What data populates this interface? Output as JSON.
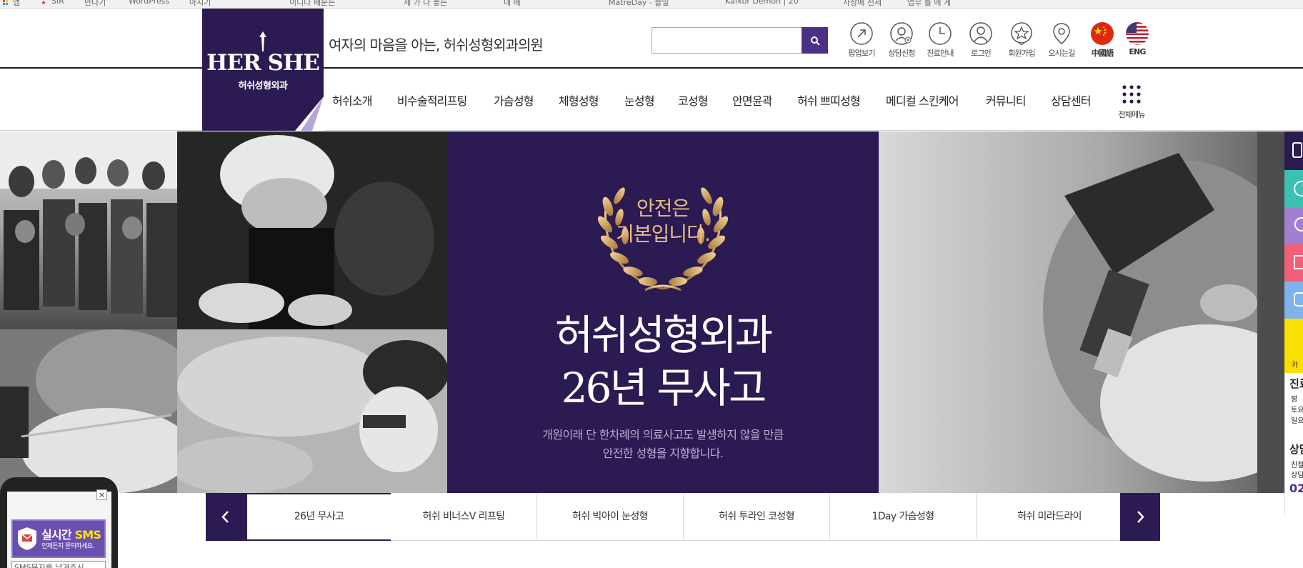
{
  "bookmarks": [
    "앱",
    "SIR",
    "만나기",
    "WordPress",
    "아시기",
    "이니다 배운는",
    "제 가 나 좋는",
    "네 베",
    "MatreDay - 블일",
    "Kafkor Demon | 20",
    "사장에 전세",
    "업무 를 에 게"
  ],
  "header": {
    "logo_main": "HER SHE",
    "logo_sub": "허쉬성형외과",
    "tagline": "여자의 마음을 아는, 허쉬성형외과의원",
    "search_placeholder": ""
  },
  "quick_links": [
    {
      "icon": "popup-icon",
      "label": "팝업보기"
    },
    {
      "icon": "consult-icon",
      "label": "상담신청"
    },
    {
      "icon": "clock-icon",
      "label": "진료안내"
    },
    {
      "icon": "user-icon",
      "label": "로그인"
    },
    {
      "icon": "member-icon",
      "label": "회원가입"
    },
    {
      "icon": "location-icon",
      "label": "오시는길"
    },
    {
      "icon": "china-flag-icon",
      "label": "中國語"
    },
    {
      "icon": "usa-flag-icon",
      "label": "ENG"
    }
  ],
  "nav": [
    "허쉬소개",
    "비수술적리프팅",
    "가슴성형",
    "체형성형",
    "눈성형",
    "코성형",
    "안면윤곽",
    "허쉬 쁘띠성형",
    "메디컬 스킨케어",
    "커뮤니티",
    "상담센터"
  ],
  "all_menu_label": "전체메뉴",
  "hero": {
    "wreath_text": [
      "안전은",
      "기본입니다."
    ],
    "title": [
      "허쉬성형외과",
      "26년 무사고"
    ],
    "desc": [
      "개원이래 단 한차례의 의료사고도 발생하지 않을 만큼",
      "안전한 성형을 지향합니다."
    ]
  },
  "tabs": [
    "26년 무사고",
    "허쉬 비너스V 리프팅",
    "허쉬 빅아이 눈성형",
    "허쉬 투라인 코성형",
    "1Day 가슴성형",
    "허쉬 미라드라이"
  ],
  "active_tab": 0,
  "sidebar": {
    "text1": [
      "진료",
      "평",
      "토요",
      "일요"
    ],
    "text2": [
      "상담",
      "친절",
      "상담"
    ],
    "phone": "02"
  },
  "sms": {
    "title_a": "실시간",
    "title_b": "SMS",
    "subtitle": "언제든지 문의하세요.",
    "input": "SMS문자를 남겨주시"
  },
  "colors": {
    "brand": "#2c1b52",
    "accent": "#4c2f86",
    "gold": "#e4bd84"
  }
}
